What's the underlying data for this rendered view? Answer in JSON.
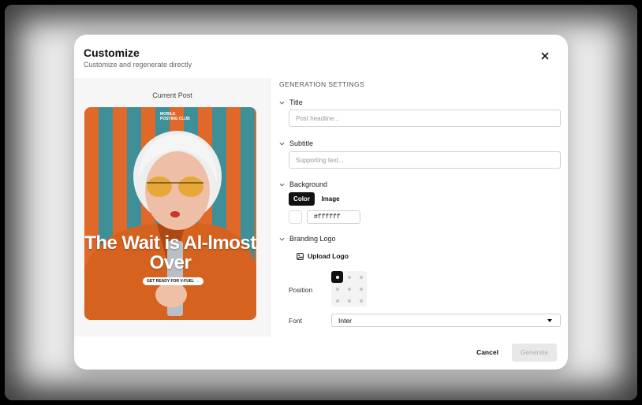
{
  "modal": {
    "title": "Customize",
    "subtitle": "Customize and regenerate directly"
  },
  "icons": {
    "close": "close-icon",
    "chevron": "chevron-down-icon",
    "upload": "image-upload-icon",
    "caret": "caret-down-icon"
  },
  "preview": {
    "label": "Current Post",
    "poster_brand": "MOBILE POSTING CLUB",
    "poster_headline": "The Wait is Al-lmost Over",
    "poster_cta": "GET READY FOR V-FUEL →"
  },
  "settings": {
    "heading": "GENERATION SETTINGS",
    "title": {
      "label": "Title",
      "placeholder": "Post headline..."
    },
    "subtitle": {
      "label": "Subtitle",
      "placeholder": "Supporting text..."
    },
    "background": {
      "label": "Background",
      "tabs": [
        "Color",
        "Image"
      ],
      "active_tab": "Color",
      "color_value": "#ffffff"
    },
    "branding": {
      "label": "Branding Logo",
      "upload_label": "Upload Logo",
      "position_label": "Position",
      "selected_position": "top-left"
    },
    "font": {
      "label": "Font",
      "value": "Inter"
    }
  },
  "footer": {
    "cancel": "Cancel",
    "generate": "Generate"
  },
  "colors": {
    "accent": "#111111",
    "poster_orange": "#e0682a",
    "poster_teal": "#3f8f98",
    "disabled_bg": "#e8e8e8"
  }
}
